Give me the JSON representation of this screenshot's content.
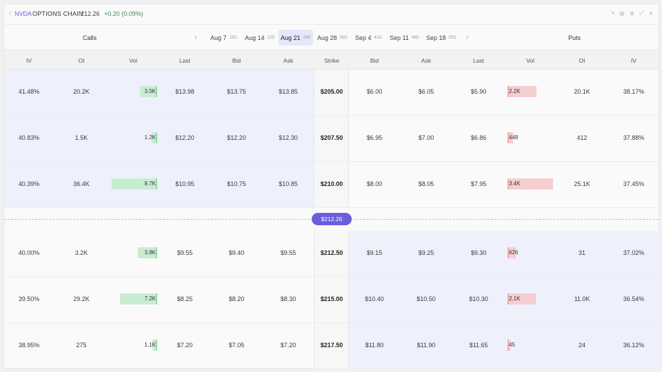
{
  "header": {
    "drag_handle": "⠿",
    "symbol": "NVDA",
    "title": "OPTIONS CHAIN",
    "price": "212.26",
    "change": "+0.20 (0.09%)",
    "icons": [
      "bolt-icon",
      "table-icon",
      "settings-icon",
      "expand-icon",
      "close-icon"
    ],
    "icon_glyphs": [
      "ϟ",
      "▤",
      "⚙",
      "⤢",
      "✕"
    ]
  },
  "expiry": {
    "calls_label": "Calls",
    "puts_label": "Puts",
    "prev": "‹",
    "next": "›",
    "tabs": [
      {
        "date": "Aug 7",
        "dte": "15D"
      },
      {
        "date": "Aug 14",
        "dte": "22D"
      },
      {
        "date": "Aug 21",
        "dte": "29D",
        "active": true
      },
      {
        "date": "Aug 28",
        "dte": "36D"
      },
      {
        "date": "Sep 4",
        "dte": "41D"
      },
      {
        "date": "Sep 11",
        "dte": "48D"
      },
      {
        "date": "Sep 18",
        "dte": "55D"
      }
    ]
  },
  "columns": {
    "calls": [
      "IV",
      "OI",
      "Vol",
      "Last",
      "Bid",
      "Ask"
    ],
    "strike": "Strike",
    "puts": [
      "Bid",
      "Ask",
      "Last",
      "Vol",
      "OI",
      "IV"
    ]
  },
  "spot_label": "$212.26",
  "colors": {
    "accent": "#6b5de0",
    "itm_bg": "#eef0fb",
    "call_vol": "#c8ecd2",
    "put_vol": "#f6cdd0",
    "positive": "#3b8a54"
  },
  "rows": [
    {
      "strike": "$205.00",
      "call": {
        "iv": "41.48%",
        "oi": "20.2K",
        "vol": "3.5K",
        "vol_frac": 0.38,
        "last": "$13.98",
        "bid": "$13.75",
        "ask": "$13.85"
      },
      "put": {
        "bid": "$6.00",
        "ask": "$6.05",
        "last": "$5.90",
        "vol": "2.2K",
        "vol_frac": 0.64,
        "oi": "20.1K",
        "iv": "38.17%"
      }
    },
    {
      "strike": "$207.50",
      "call": {
        "iv": "40.83%",
        "oi": "1.5K",
        "vol": "1.2K",
        "vol_frac": 0.12,
        "last": "$12.20",
        "bid": "$12.20",
        "ask": "$12.30"
      },
      "put": {
        "bid": "$6.95",
        "ask": "$7.00",
        "last": "$6.86",
        "vol": "448",
        "vol_frac": 0.12,
        "oi": "412",
        "iv": "37.88%"
      }
    },
    {
      "strike": "$210.00",
      "call": {
        "iv": "40.39%",
        "oi": "36.4K",
        "vol": "8.7K",
        "vol_frac": 1.0,
        "last": "$10.95",
        "bid": "$10.75",
        "ask": "$10.85"
      },
      "put": {
        "bid": "$8.00",
        "ask": "$8.05",
        "last": "$7.95",
        "vol": "3.4K",
        "vol_frac": 1.0,
        "oi": "25.1K",
        "iv": "37.45%"
      }
    },
    {
      "strike": "$212.50",
      "call": {
        "iv": "40.00%",
        "oi": "3.2K",
        "vol": "3.8K",
        "vol_frac": 0.43,
        "last": "$9.55",
        "bid": "$9.40",
        "ask": "$9.55"
      },
      "put": {
        "bid": "$9.15",
        "ask": "$9.25",
        "last": "$9.30",
        "vol": "626",
        "vol_frac": 0.18,
        "oi": "31",
        "iv": "37.02%"
      }
    },
    {
      "strike": "$215.00",
      "call": {
        "iv": "39.50%",
        "oi": "29.2K",
        "vol": "7.2K",
        "vol_frac": 0.82,
        "last": "$8.25",
        "bid": "$8.20",
        "ask": "$8.30"
      },
      "put": {
        "bid": "$10.40",
        "ask": "$10.50",
        "last": "$10.30",
        "vol": "2.1K",
        "vol_frac": 0.62,
        "oi": "11.0K",
        "iv": "36.54%"
      }
    },
    {
      "strike": "$217.50",
      "call": {
        "iv": "38.95%",
        "oi": "275",
        "vol": "1.1K",
        "vol_frac": 0.1,
        "last": "$7.20",
        "bid": "$7.05",
        "ask": "$7.20"
      },
      "put": {
        "bid": "$11.80",
        "ask": "$11.90",
        "last": "$11.65",
        "vol": "45",
        "vol_frac": 0.04,
        "oi": "24",
        "iv": "36.12%"
      }
    }
  ]
}
